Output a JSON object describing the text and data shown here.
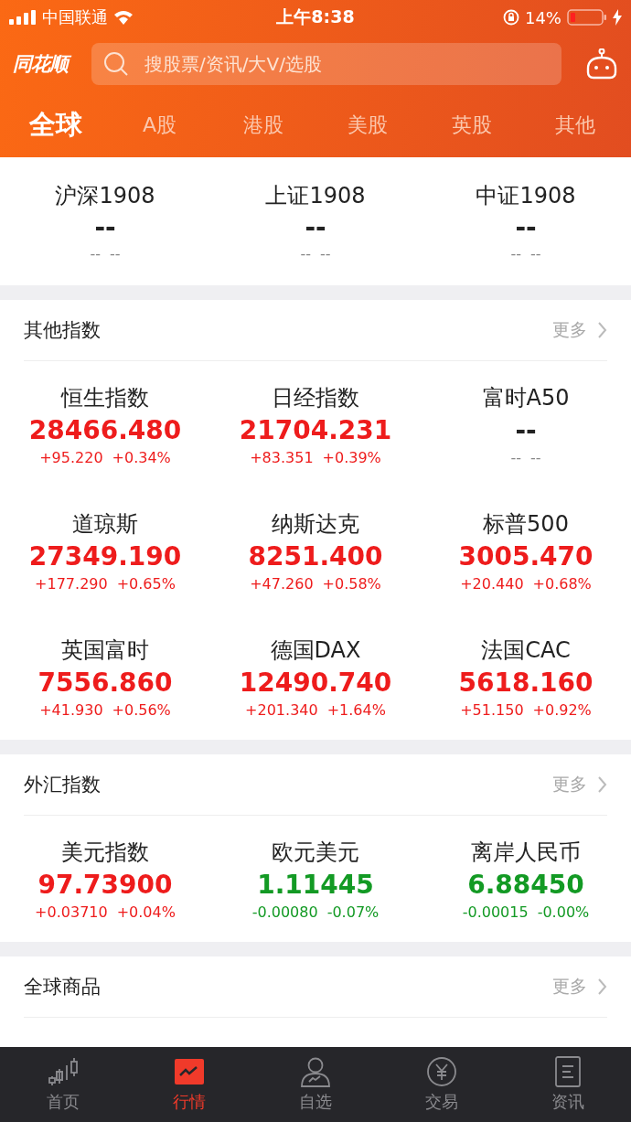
{
  "status_bar": {
    "carrier": "中国联通",
    "time": "上午8:38",
    "battery": "14%"
  },
  "header": {
    "logo": "同花顺",
    "search": {
      "placeholder": "搜股票/资讯/大V/选股"
    }
  },
  "tabs": [
    {
      "label": "全球",
      "selected": true
    },
    {
      "label": "A股",
      "selected": false
    },
    {
      "label": "港股",
      "selected": false
    },
    {
      "label": "美股",
      "selected": false
    },
    {
      "label": "英股",
      "selected": false
    },
    {
      "label": "其他",
      "selected": false
    }
  ],
  "main_indices": [
    {
      "name": "沪深1908",
      "value": "--",
      "change": "--",
      "percent": "--"
    },
    {
      "name": "上证1908",
      "value": "--",
      "change": "--",
      "percent": "--"
    },
    {
      "name": "中证1908",
      "value": "--",
      "change": "--",
      "percent": "--"
    }
  ],
  "sections": [
    {
      "title": "其他指数",
      "more": "更多",
      "items": [
        {
          "name": "恒生指数",
          "value": "28466.480",
          "change": "+95.220",
          "percent": "+0.34%",
          "color": "#ee1c1c"
        },
        {
          "name": "日经指数",
          "value": "21704.231",
          "change": "+83.351",
          "percent": "+0.39%",
          "color": "#ee1c1c"
        },
        {
          "name": "富时A50",
          "value": "--",
          "change": "--",
          "percent": "--",
          "color": "#222222"
        },
        {
          "name": "道琼斯",
          "value": "27349.190",
          "change": "+177.290",
          "percent": "+0.65%",
          "color": "#ee1c1c"
        },
        {
          "name": "纳斯达克",
          "value": "8251.400",
          "change": "+47.260",
          "percent": "+0.58%",
          "color": "#ee1c1c"
        },
        {
          "name": "标普500",
          "value": "3005.470",
          "change": "+20.440",
          "percent": "+0.68%",
          "color": "#ee1c1c"
        },
        {
          "name": "英国富时",
          "value": "7556.860",
          "change": "+41.930",
          "percent": "+0.56%",
          "color": "#ee1c1c"
        },
        {
          "name": "德国DAX",
          "value": "12490.740",
          "change": "+201.340",
          "percent": "+1.64%",
          "color": "#ee1c1c"
        },
        {
          "name": "法国CAC",
          "value": "5618.160",
          "change": "+51.150",
          "percent": "+0.92%",
          "color": "#ee1c1c"
        }
      ]
    },
    {
      "title": "外汇指数",
      "more": "更多",
      "items": [
        {
          "name": "美元指数",
          "value": "97.73900",
          "change": "+0.03710",
          "percent": "+0.04%",
          "color": "#ee1c1c"
        },
        {
          "name": "欧元美元",
          "value": "1.11445",
          "change": "-0.00080",
          "percent": "-0.07%",
          "color": "#139a24"
        },
        {
          "name": "离岸人民币",
          "value": "6.88450",
          "change": "-0.00015",
          "percent": "-0.00%",
          "color": "#139a24"
        }
      ]
    },
    {
      "title": "全球商品",
      "more": "更多"
    }
  ],
  "nav": [
    {
      "label": "首页",
      "selected": false,
      "kind": "candles"
    },
    {
      "label": "行情",
      "selected": true,
      "kind": "chart"
    },
    {
      "label": "自选",
      "selected": false,
      "kind": "person"
    },
    {
      "label": "交易",
      "selected": false,
      "kind": "yen"
    },
    {
      "label": "资讯",
      "selected": false,
      "kind": "doc"
    }
  ]
}
